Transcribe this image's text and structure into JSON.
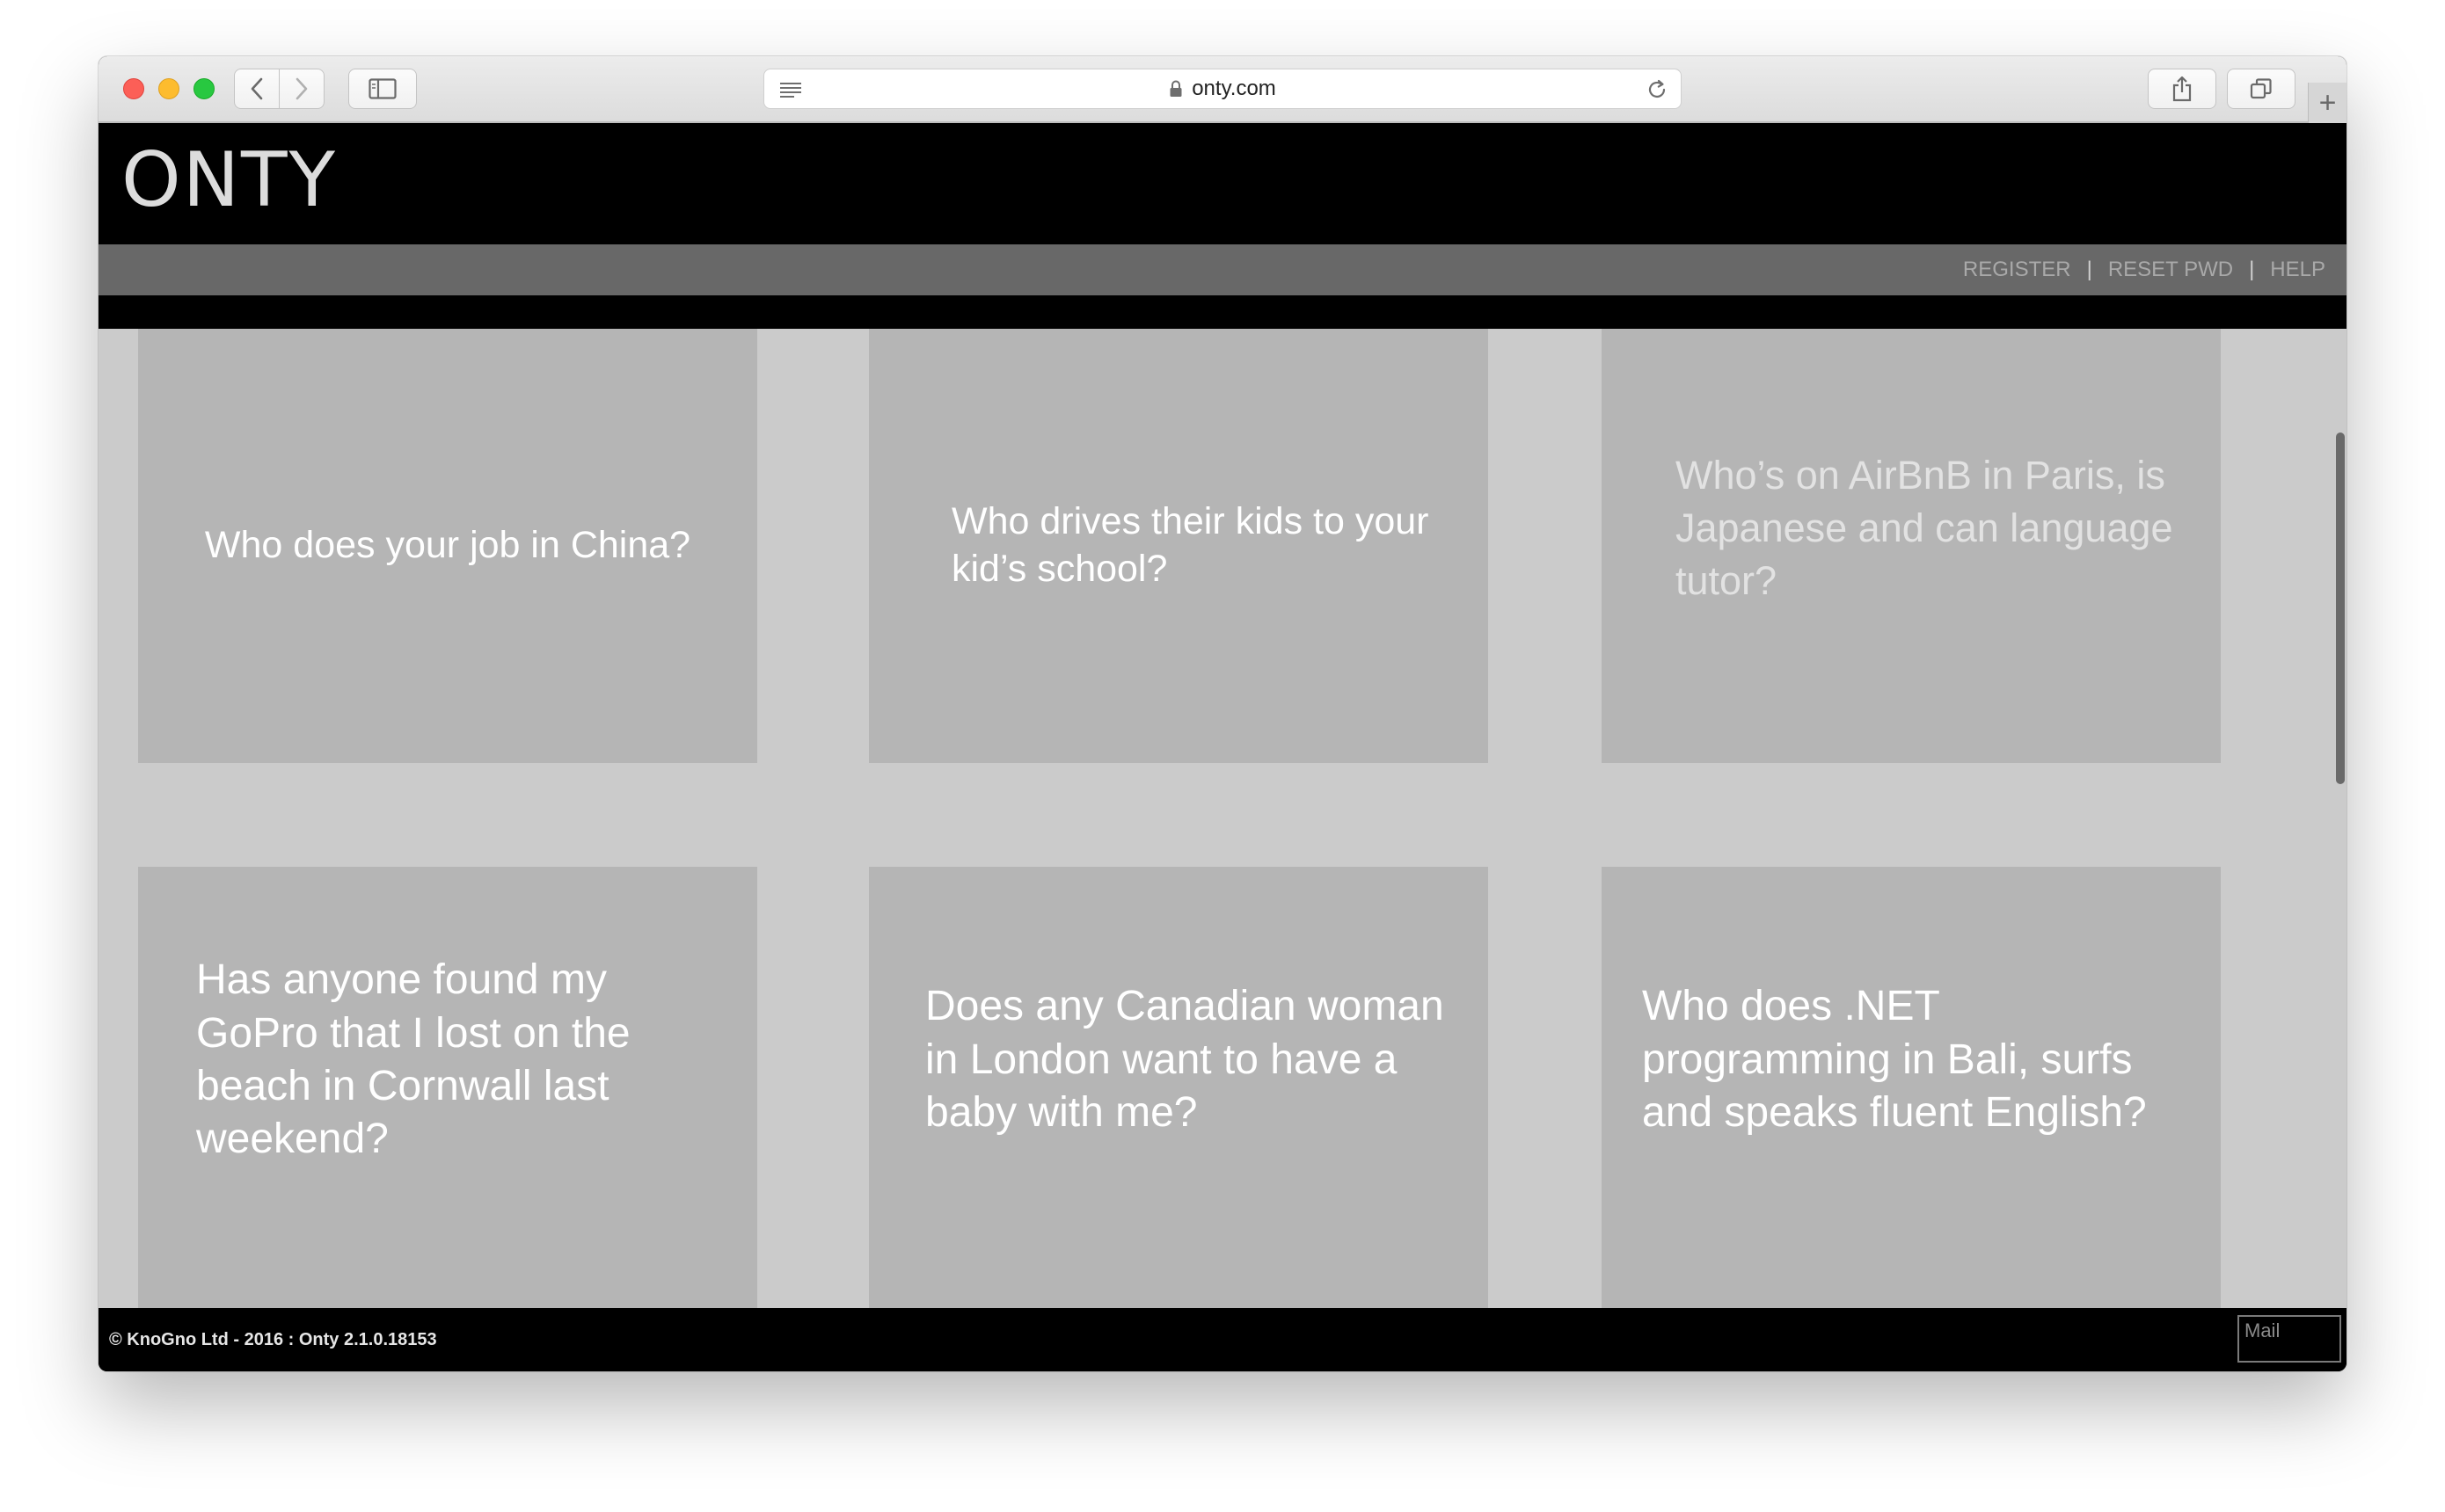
{
  "browser": {
    "url": "onty.com"
  },
  "site": {
    "logo": "ONTY",
    "nav": [
      {
        "label": "REGISTER"
      },
      {
        "label": "RESET PWD"
      },
      {
        "label": "HELP"
      }
    ],
    "nav_separator": "|"
  },
  "cards": [
    {
      "text": "Who does your job in China?"
    },
    {
      "text": "Who drives their kids to your kid’s school?"
    },
    {
      "text": "Who’s on AirBnB in Paris, is Japanese and can language tutor?"
    },
    {
      "text": "Has anyone found my GoPro that I lost on the beach in Cornwall last weekend?"
    },
    {
      "text": "Does any Canadian woman in London want to have a baby with me?"
    },
    {
      "text": "Who does .NET programming in Bali, surfs and speaks fluent English?"
    }
  ],
  "footer": {
    "copyright": "© KnoGno Ltd - 2016 : Onty 2.1.0.18153",
    "mail_placeholder": "Mail"
  },
  "colors": {
    "page_bg": "#000000",
    "nav_bar": "#686868",
    "content_bg": "#cbcbcb",
    "card_bg": "#b5b5b5",
    "card_text": "#ffffff"
  },
  "icons": {
    "back": "chevron-left-icon",
    "forward": "chevron-right-icon",
    "sidebar": "sidebar-icon",
    "reader": "reader-icon",
    "lock": "lock-icon",
    "reload": "reload-icon",
    "share": "share-icon",
    "tabs": "tabs-icon",
    "new_tab": "plus-icon"
  }
}
